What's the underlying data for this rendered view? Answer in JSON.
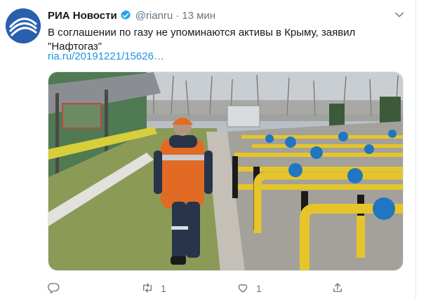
{
  "tweet": {
    "author_name": "РИА Новости",
    "handle": "@rianru",
    "separator": "·",
    "time": "13 мин",
    "text": "В соглашении по газу не упоминаются активы в Крыму, заявил \"Нафтогаз\"",
    "link": "ria.ru/20191221/15626…"
  },
  "actions": {
    "retweet_count": "1",
    "like_count": "1"
  },
  "colors": {
    "link": "#1b95e0",
    "verified": "#1da1f2",
    "muted": "#657786",
    "avatar_bg": "#2a5fae"
  },
  "icons": {
    "reply": "reply-icon",
    "retweet": "retweet-icon",
    "like": "heart-icon",
    "share": "share-icon",
    "verified": "verified-badge-icon",
    "menu": "chevron-down-icon"
  }
}
